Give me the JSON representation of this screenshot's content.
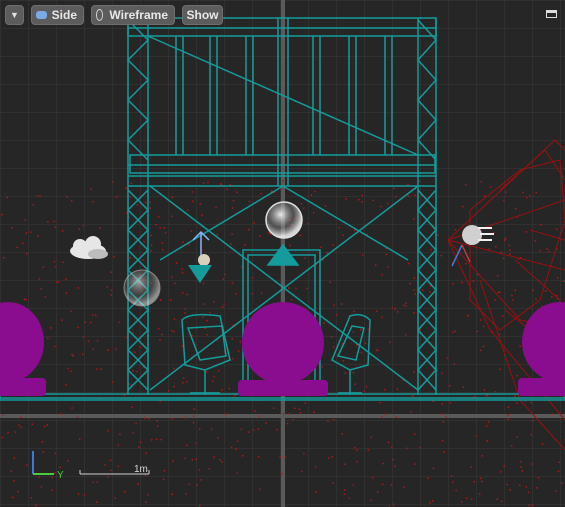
{
  "toolbar": {
    "menu_icon": "chevron-down-icon",
    "view_label": "Side",
    "view_icon": "side-view-icon",
    "mode_label": "Wireframe",
    "mode_icon": "wireframe-sphere-icon",
    "show_label": "Show"
  },
  "window": {
    "maximize_icon": "maximize-icon"
  },
  "axis_gizmo": {
    "y_label": "Y",
    "y_color": "#4ccd3c",
    "z_color": "#3a7bd5"
  },
  "scale": {
    "label": "1m"
  },
  "colors": {
    "background": "#262626",
    "grid": "#4a4a4a",
    "wireframe": "#14a7a7",
    "actors": "#8a0c8f",
    "particles": "#b01818",
    "camera_frustum": "#a01010"
  }
}
